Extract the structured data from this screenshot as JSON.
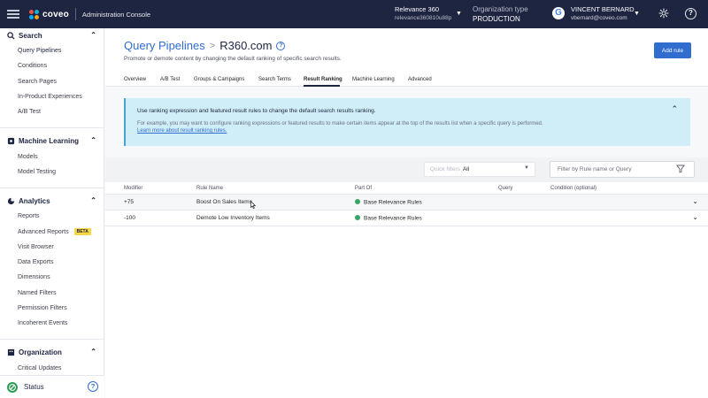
{
  "topbar": {
    "logo_text": "coveo",
    "console_title": "Administration Console",
    "org_name": "Relevance 360",
    "org_id": "relevance360810u88p",
    "org_type_label": "Organization type",
    "org_type_value": "PRODUCTION",
    "user_name": "VINCENT BERNARD",
    "user_email": "vbernard@coveo.com",
    "icons": [
      "hamburger-icon",
      "coveo-logo",
      "chevron-down-icon",
      "google-avatar",
      "gear-icon",
      "help-icon"
    ]
  },
  "sidebar": {
    "groups": [
      {
        "label": "Search",
        "items": [
          "Query Pipelines",
          "Conditions",
          "Search Pages",
          "In-Product Experiences",
          "A/B Test"
        ]
      },
      {
        "label": "Machine Learning",
        "items": [
          "Models",
          "Model Testing"
        ]
      },
      {
        "label": "Analytics",
        "items": [
          "Reports",
          "Advanced Reports",
          "Visit Browser",
          "Data Exports",
          "Dimensions",
          "Named Filters",
          "Permission Filters",
          "Incoherent Events"
        ]
      },
      {
        "label": "Organization",
        "items": [
          "Critical Updates"
        ]
      }
    ],
    "beta_badge": "BETA",
    "status_label": "Status"
  },
  "header": {
    "breadcrumb": "Query Pipelines",
    "breadcrumb_sep": ">",
    "current": "R360.com",
    "subtitle": "Promote or demote content by changing the default ranking of specific search results.",
    "add_button": "Add rule"
  },
  "tabs": [
    "Overview",
    "A/B Test",
    "Groups & Campaigns",
    "Search Terms",
    "Result Ranking",
    "Machine Learning",
    "Advanced"
  ],
  "active_tab": "Result Ranking",
  "info": {
    "line1": "Use ranking expression and featured result rules to change the default search results ranking.",
    "line2": "For example, you may want to configure ranking expressions or featured results to make certain items appear at the top of the results list when a specific query is performed.",
    "link": "Learn more about result ranking rules."
  },
  "filters": {
    "quick_label": "Quick filters",
    "quick_value": "All",
    "search_placeholder": "Filter by Rule name or Query"
  },
  "table": {
    "headers": [
      "Modifier",
      "Rule Name",
      "Part Of",
      "Query",
      "Condition (optional)"
    ],
    "rows": [
      {
        "modifier": "+75",
        "rule": "Boost On Sales Items",
        "part_of": "Base Relevance Rules",
        "query": "",
        "condition": ""
      },
      {
        "modifier": "-100",
        "rule": "Demote Low Inventory Items",
        "part_of": "Base Relevance Rules",
        "query": "",
        "condition": ""
      }
    ]
  },
  "colors": {
    "topbar": "#1e2541",
    "accent": "#316ccf",
    "info_bg": "#cfeef8",
    "status_green": "#2e9e59",
    "rule_dot": "#3aa569",
    "beta": "#f8d646"
  }
}
